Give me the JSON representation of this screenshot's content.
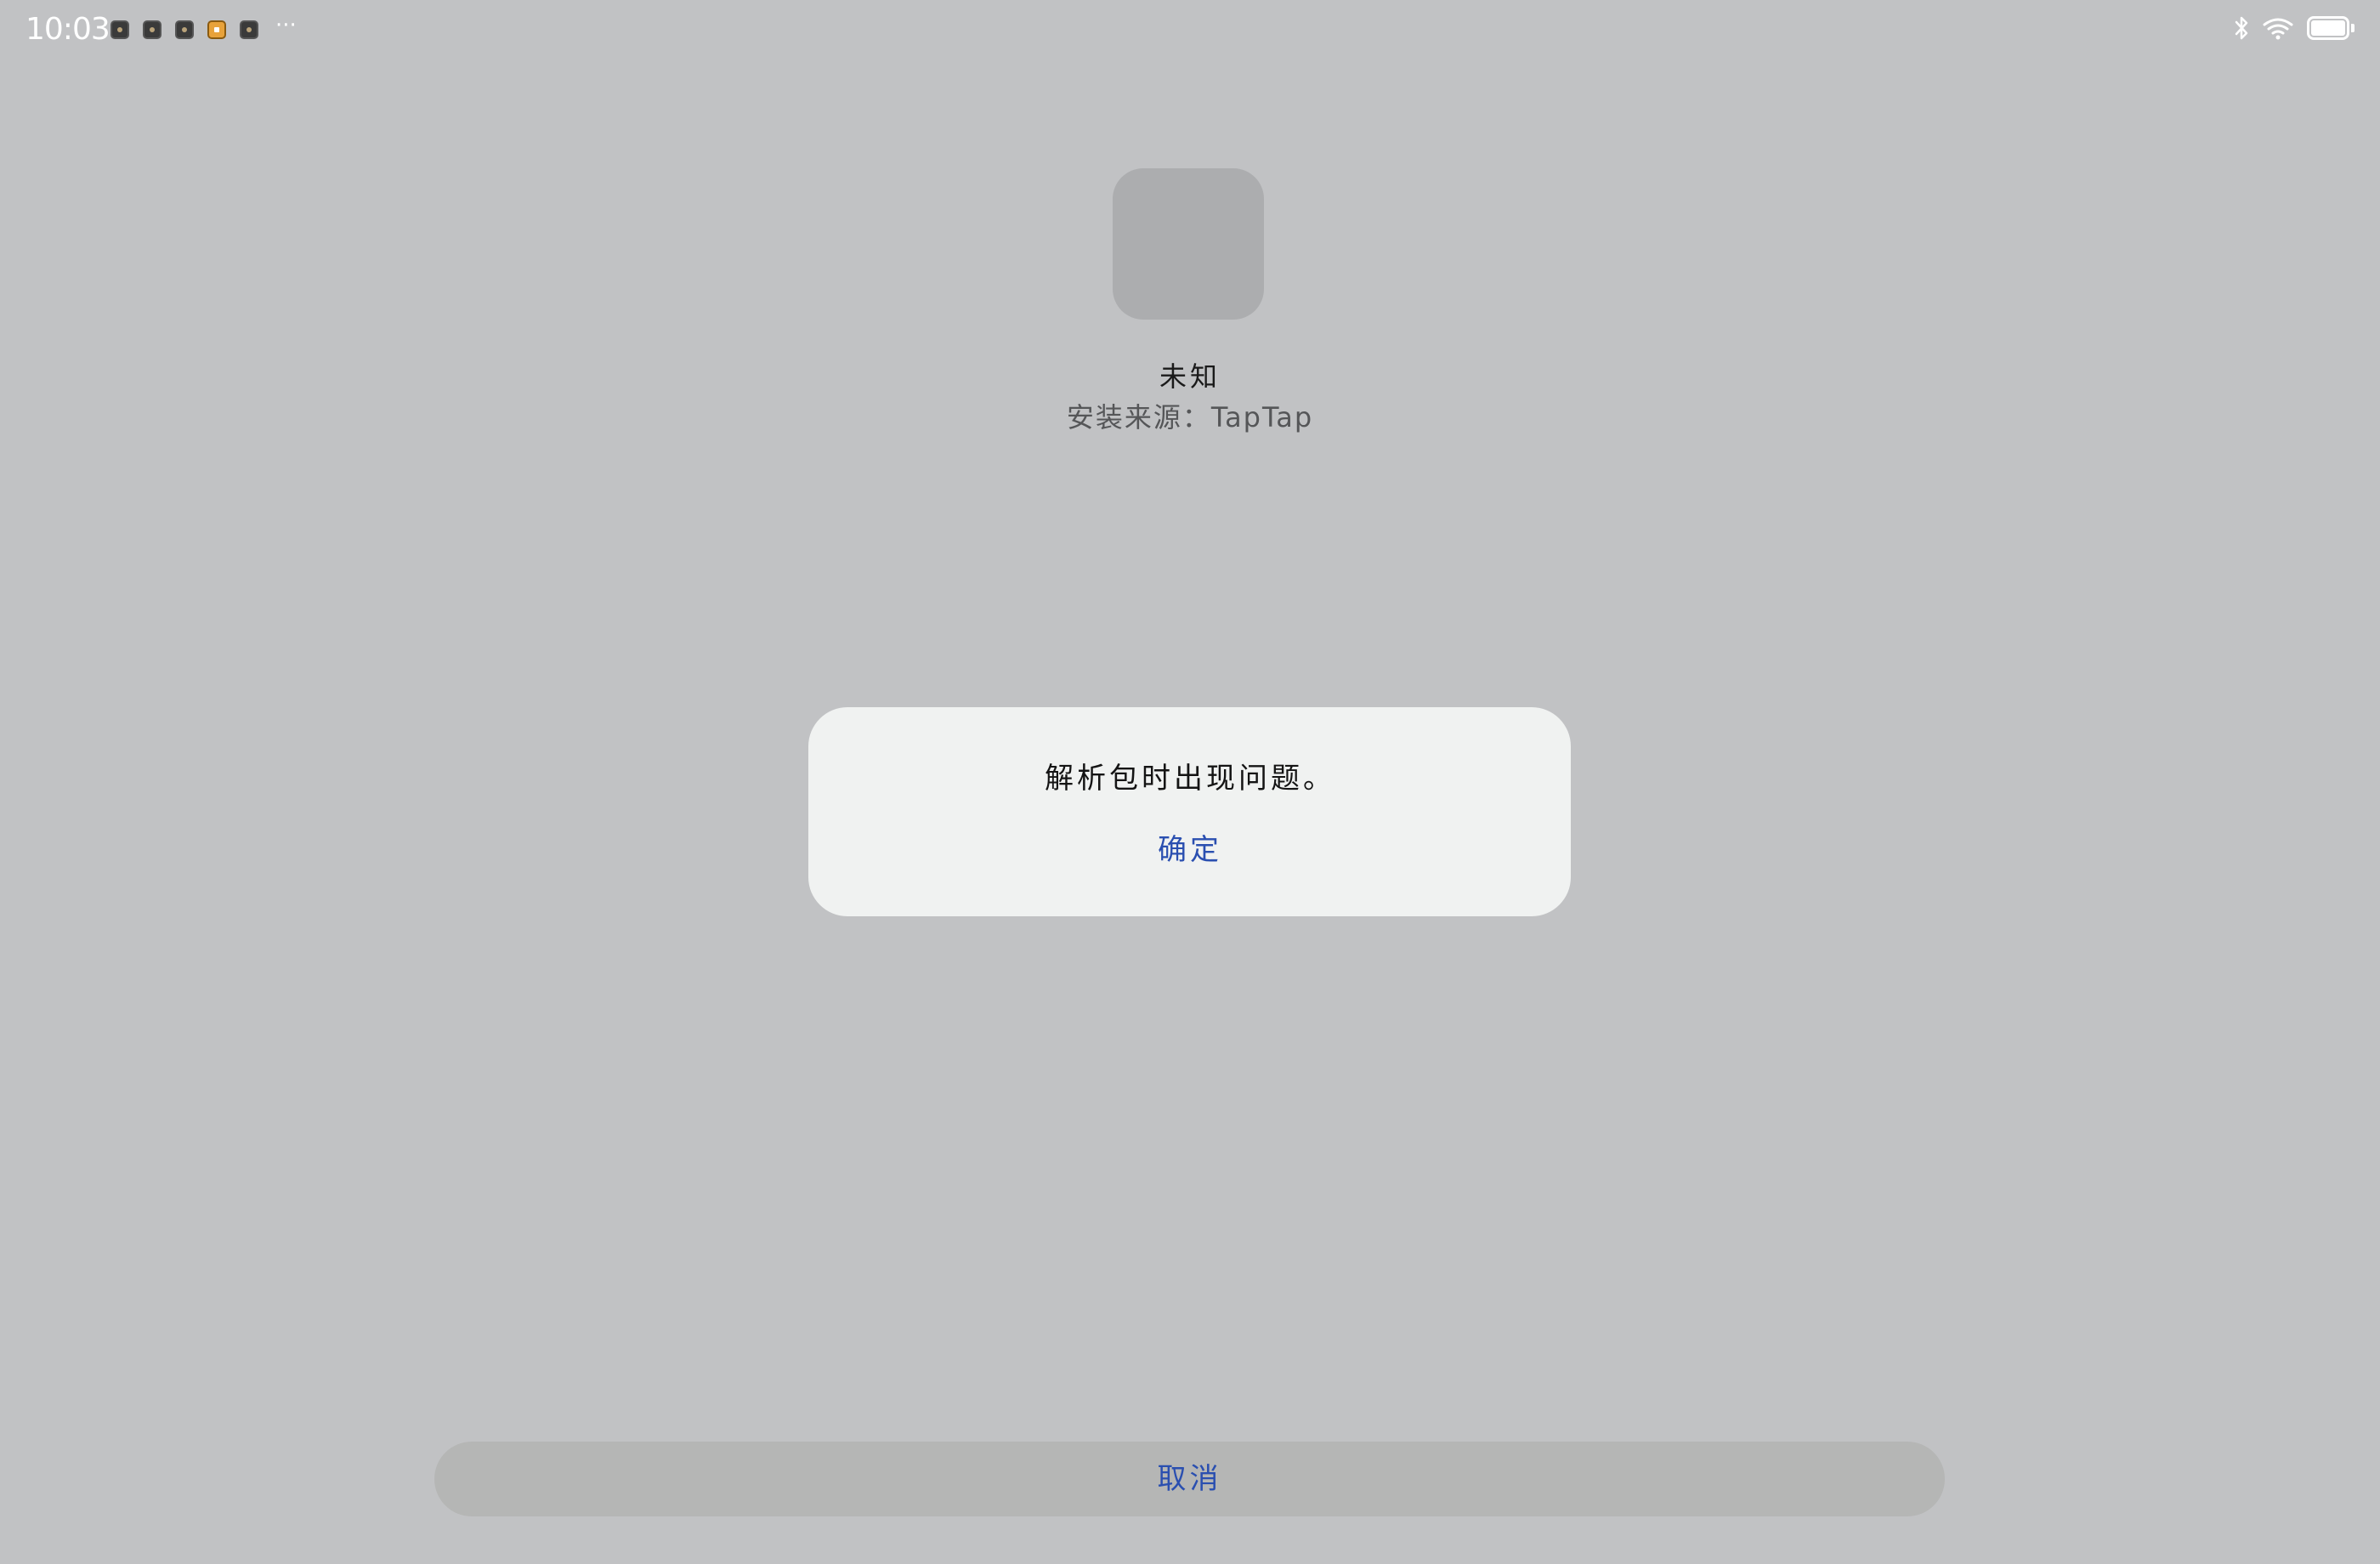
{
  "status_bar": {
    "time": "10:03",
    "notification_icons": [
      "app-notification-icon",
      "app-notification-icon",
      "app-notification-icon",
      "app-notification-icon",
      "app-notification-icon"
    ],
    "more": "···",
    "right_icons": [
      "bluetooth-icon",
      "wifi-icon",
      "battery-icon"
    ]
  },
  "app": {
    "name": "未知",
    "source": "安装来源：TapTap"
  },
  "dialog": {
    "message": "解析包时出现问题。",
    "confirm_label": "确定"
  },
  "footer": {
    "cancel_label": "取消"
  },
  "colors": {
    "background": "#c1c2c4",
    "dialog_background": "#f0f2f1",
    "accent": "#2a4fb0",
    "cancel_background": "#b5b6b5",
    "app_icon_placeholder": "#acadaf"
  }
}
